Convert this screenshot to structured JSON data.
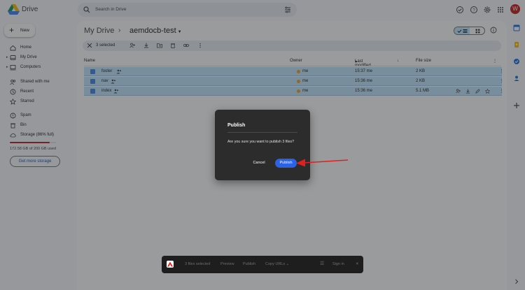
{
  "app": {
    "name": "Drive",
    "avatar_letter": "W",
    "accent_color": "#0b57d0"
  },
  "search": {
    "placeholder": "Search in Drive"
  },
  "sidebar": {
    "new_label": "New",
    "items": [
      {
        "label": "Home",
        "icon": "home-icon"
      },
      {
        "label": "My Drive",
        "icon": "drive-icon"
      },
      {
        "label": "Computers",
        "icon": "computer-icon"
      },
      {
        "label": "Shared with me",
        "icon": "people-icon"
      },
      {
        "label": "Recent",
        "icon": "clock-icon"
      },
      {
        "label": "Starred",
        "icon": "star-icon"
      },
      {
        "label": "Spam",
        "icon": "spam-icon"
      },
      {
        "label": "Bin",
        "icon": "trash-icon"
      },
      {
        "label": "Storage (86% full)",
        "icon": "cloud-icon"
      }
    ],
    "storage_percent": 86,
    "storage_text": "172.58 GB of 200 GB used",
    "get_storage_label": "Get more storage"
  },
  "breadcrumb": {
    "root": "My Drive",
    "separator": "›",
    "current": "aemdocb-test"
  },
  "selection_bar": {
    "text": "3 selected"
  },
  "table": {
    "headers": {
      "name": "Name",
      "owner": "Owner",
      "modified": "Last modified",
      "size": "File size"
    },
    "rows": [
      {
        "name": "footer",
        "owner": "me",
        "modified": "15:37 me",
        "size": "2 KB"
      },
      {
        "name": "nav",
        "owner": "me",
        "modified": "15:36 me",
        "size": "2 KB"
      },
      {
        "name": "index",
        "owner": "me",
        "modified": "15:36 me",
        "size": "5.1 MB"
      }
    ]
  },
  "dialog": {
    "title": "Publish",
    "message": "Are you sure you want to publish 3 files?",
    "cancel_label": "Cancel",
    "confirm_label": "Publish"
  },
  "bottom_toolbar": {
    "files_selected": "3 files selected",
    "preview": "Preview",
    "publish": "Publish",
    "copy_urls": "Copy URLs",
    "sign_in": "Sign in"
  }
}
